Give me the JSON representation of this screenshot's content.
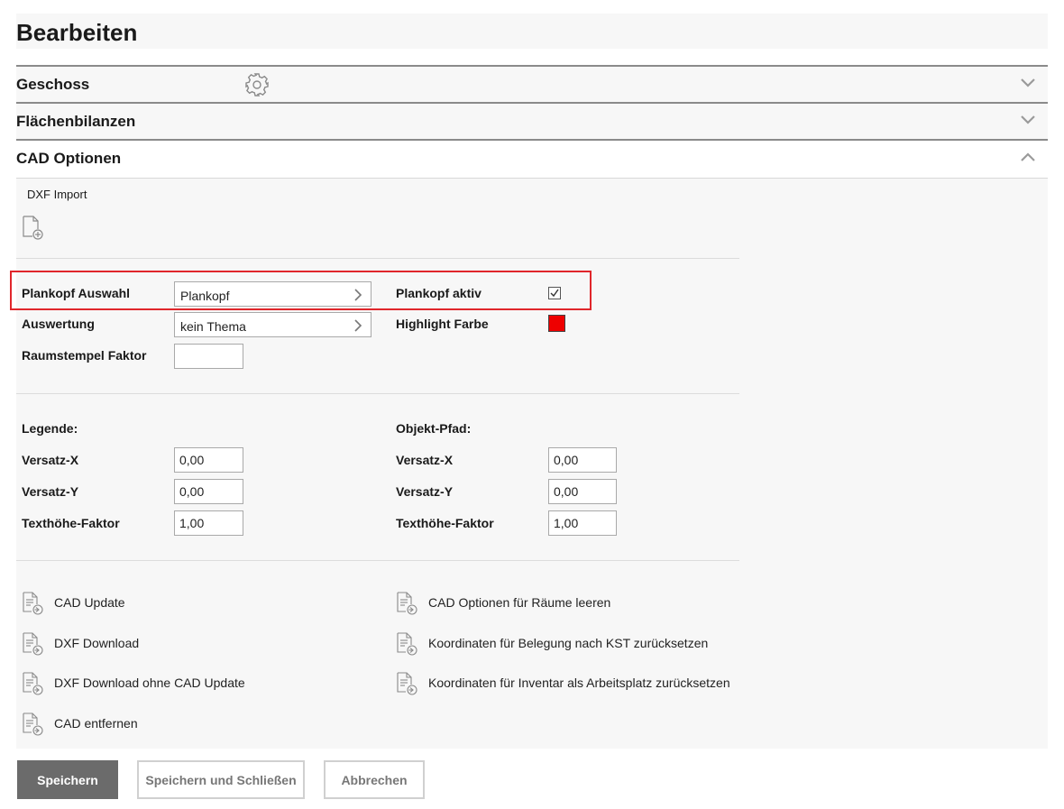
{
  "page": {
    "title": "Bearbeiten"
  },
  "sections": {
    "geschoss": {
      "title": "Geschoss",
      "icon": "gear-icon",
      "state": "collapsed"
    },
    "flaechenbilanzen": {
      "title": "Flächenbilanzen",
      "state": "collapsed"
    },
    "cad_optionen": {
      "title": "CAD Optionen",
      "state": "expanded"
    }
  },
  "cad": {
    "dxf_import": {
      "label": "DXF Import",
      "icon": "file-add-icon"
    },
    "plankopf_auswahl": {
      "label": "Plankopf Auswahl",
      "value": "Plankopf"
    },
    "plankopf_aktiv": {
      "label": "Plankopf aktiv",
      "checked": true
    },
    "auswertung": {
      "label": "Auswertung",
      "value": "kein Thema"
    },
    "highlight_farbe": {
      "label": "Highlight Farbe",
      "color": "#ee0000"
    },
    "raumstempel": {
      "label": "Raumstempel Faktor",
      "value": ""
    },
    "legende": {
      "heading": "Legende:",
      "versatz_x": {
        "label": "Versatz-X",
        "value": "0,00"
      },
      "versatz_y": {
        "label": "Versatz-Y",
        "value": "0,00"
      },
      "texthoehe": {
        "label": "Texthöhe-Faktor",
        "value": "1,00"
      }
    },
    "objekt_pfad": {
      "heading": "Objekt-Pfad:",
      "versatz_x": {
        "label": "Versatz-X",
        "value": "0,00"
      },
      "versatz_y": {
        "label": "Versatz-Y",
        "value": "0,00"
      },
      "texthoehe": {
        "label": "Texthöhe-Faktor",
        "value": "1,00"
      }
    },
    "actions": {
      "cad_update": "CAD Update",
      "dxf_download": "DXF Download",
      "dxf_download_ohne": "DXF Download ohne CAD Update",
      "cad_entfernen": "CAD entfernen",
      "cad_optionen_leeren": "CAD Optionen für Räume leeren",
      "koord_belegung": "Koordinaten für Belegung nach KST zurücksetzen",
      "koord_inventar": "Koordinaten für Inventar als Arbeitsplatz zurücksetzen"
    }
  },
  "footer": {
    "save": "Speichern",
    "save_close": "Speichern und Schließen",
    "cancel": "Abbrechen"
  },
  "colors": {
    "highlight_border": "#e0262b",
    "primary_button": "#6b6b6b"
  }
}
